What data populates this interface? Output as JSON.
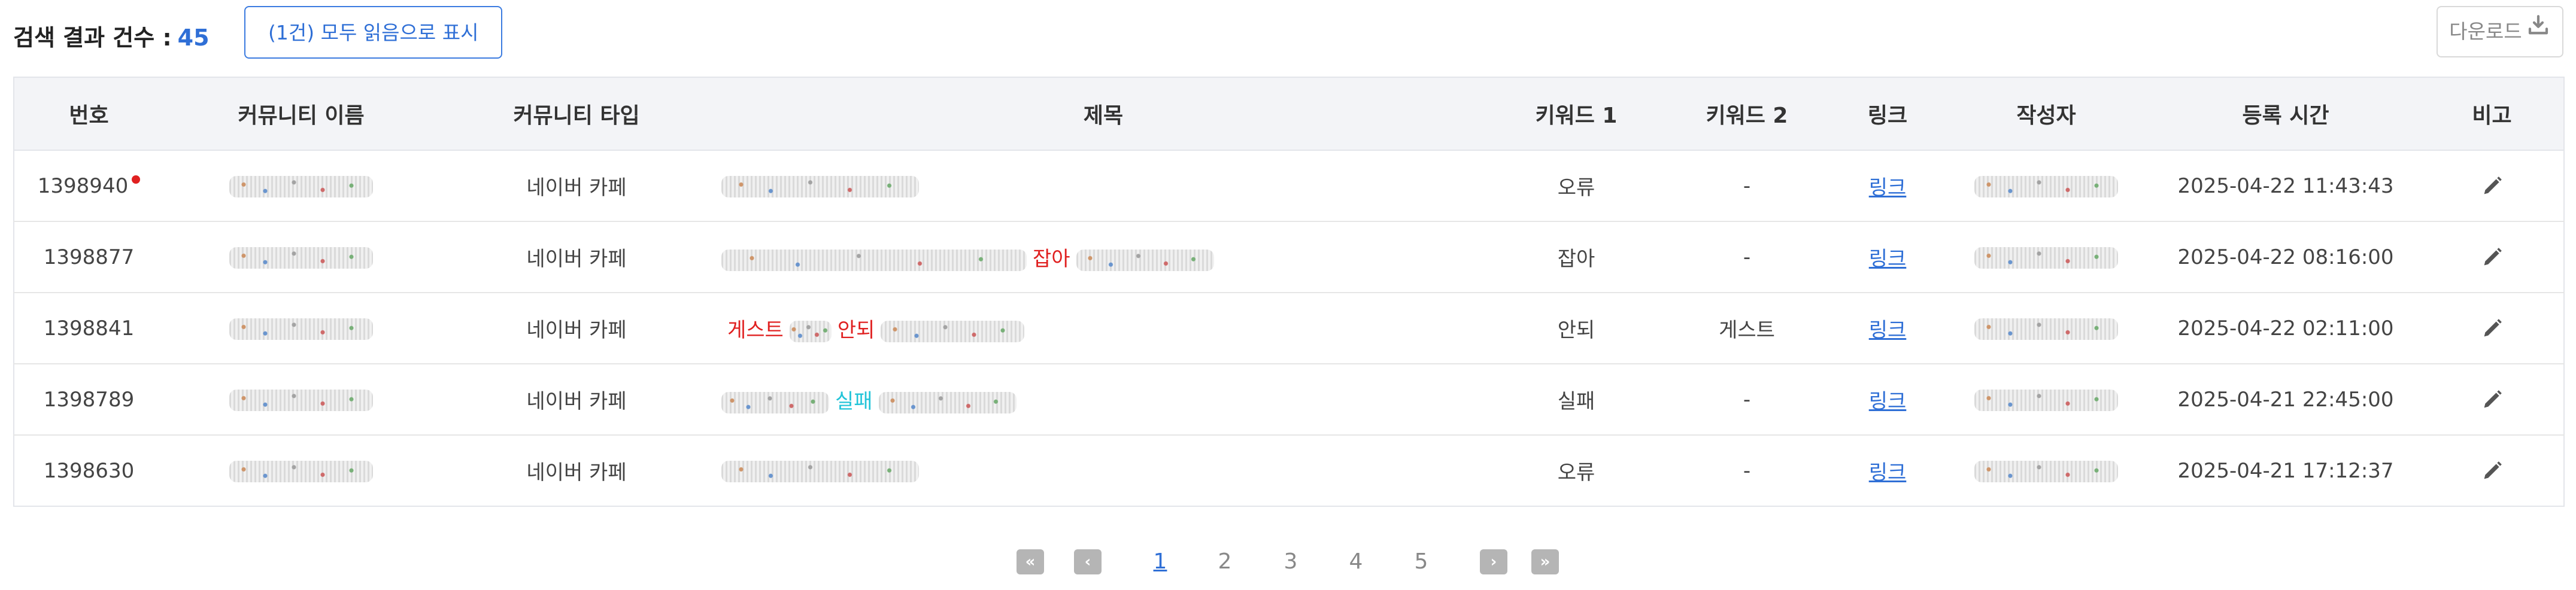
{
  "header": {
    "count_label": "검색 결과 건수 :",
    "count_value": "45",
    "mark_all_read": "(1건) 모두 읽음으로 표시",
    "download": "다운로드"
  },
  "table": {
    "columns": [
      "번호",
      "커뮤니티 이름",
      "커뮤니티 타입",
      "제목",
      "키워드 1",
      "키워드 2",
      "링크",
      "작성자",
      "등록 시간",
      "비고"
    ],
    "rows": [
      {
        "id": "1398940",
        "unread": true,
        "community_type": "네이버 카페",
        "title_keywords": [],
        "keyword1": "오류",
        "keyword2": "-",
        "link": "링크",
        "time": "2025-04-22 11:43:43"
      },
      {
        "id": "1398877",
        "unread": false,
        "community_type": "네이버 카페",
        "title_keywords": [
          "잡아"
        ],
        "keyword1": "잡아",
        "keyword2": "-",
        "link": "링크",
        "time": "2025-04-22 08:16:00"
      },
      {
        "id": "1398841",
        "unread": false,
        "community_type": "네이버 카페",
        "title_keywords": [
          "게스트",
          "안되"
        ],
        "keyword1": "안되",
        "keyword2": "게스트",
        "link": "링크",
        "time": "2025-04-22 02:11:00"
      },
      {
        "id": "1398789",
        "unread": false,
        "community_type": "네이버 카페",
        "title_keywords": [
          "실패"
        ],
        "keyword1": "실패",
        "keyword2": "-",
        "link": "링크",
        "time": "2025-04-21 22:45:00"
      },
      {
        "id": "1398630",
        "unread": false,
        "community_type": "네이버 카페",
        "title_keywords": [],
        "keyword1": "오류",
        "keyword2": "-",
        "link": "링크",
        "time": "2025-04-21 17:12:37"
      }
    ]
  },
  "pagination": {
    "pages": [
      "1",
      "2",
      "3",
      "4",
      "5"
    ],
    "current": "1"
  },
  "colors": {
    "accent": "#2f6fd6",
    "keyword_red": "#e02020",
    "keyword_cyan": "#22c4d8",
    "header_bg": "#f3f4f7"
  }
}
